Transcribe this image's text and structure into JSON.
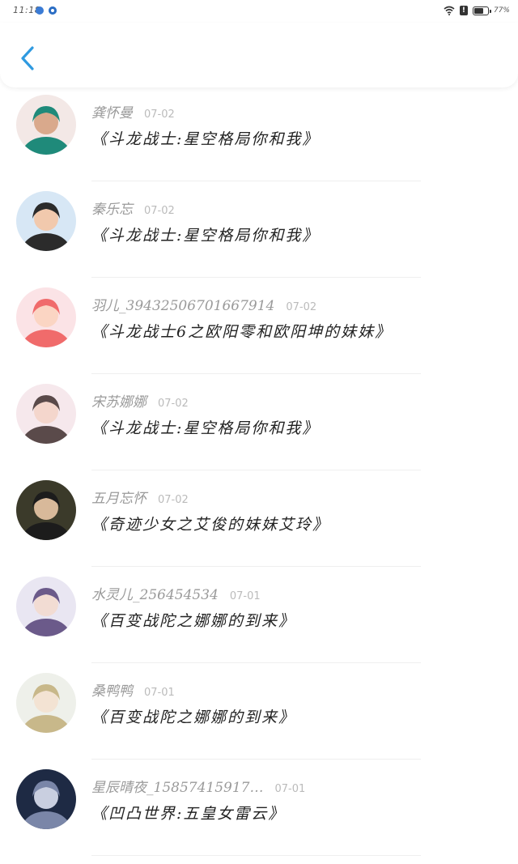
{
  "status_bar": {
    "time": "11:18",
    "battery_level": 0.77,
    "battery_text": "77%"
  },
  "nav": {
    "back_icon": "chevron-left-icon",
    "accent_color": "#2f9ae0"
  },
  "items": [
    {
      "user": "龚怀曼",
      "date": "07-02",
      "title": "《斗龙战士:星空格局你和我》",
      "avatar": [
        "#f3e8e6",
        "#1f8a7a",
        "#d9a98c"
      ]
    },
    {
      "user": "秦乐忘",
      "date": "07-02",
      "title": "《斗龙战士:星空格局你和我》",
      "avatar": [
        "#d7e7f5",
        "#2b2b2b",
        "#f1c9ad"
      ]
    },
    {
      "user": "羽儿_39432506701667914",
      "date": "07-02",
      "title": "《斗龙战士6之欧阳零和欧阳坤的妹妹》",
      "avatar": [
        "#fbe3e6",
        "#f06b6b",
        "#fbd5c3"
      ]
    },
    {
      "user": "宋苏娜娜",
      "date": "07-02",
      "title": "《斗龙战士:星空格局你和我》",
      "avatar": [
        "#f6e8ec",
        "#5a4a4a",
        "#f4d6cc"
      ]
    },
    {
      "user": "五月忘怀",
      "date": "07-02",
      "title": "《奇迹少女之艾俊的妹妹艾玲》",
      "avatar": [
        "#3b3a2a",
        "#1c1c1c",
        "#d8b99a"
      ]
    },
    {
      "user": "水灵儿_256454534",
      "date": "07-01",
      "title": "《百变战陀之娜娜的到来》",
      "avatar": [
        "#e9e6f2",
        "#6b5a8a",
        "#f2dcd3"
      ]
    },
    {
      "user": "桑鸭鸭",
      "date": "07-01",
      "title": "《百变战陀之娜娜的到来》",
      "avatar": [
        "#eef0ea",
        "#c8b88a",
        "#f3e3d3"
      ]
    },
    {
      "user": "星辰晴夜_15857415917…",
      "date": "07-01",
      "title": "《凹凸世界:五皇女雷云》",
      "avatar": [
        "#1e2a44",
        "#7a86a8",
        "#c9cfe0"
      ]
    }
  ]
}
